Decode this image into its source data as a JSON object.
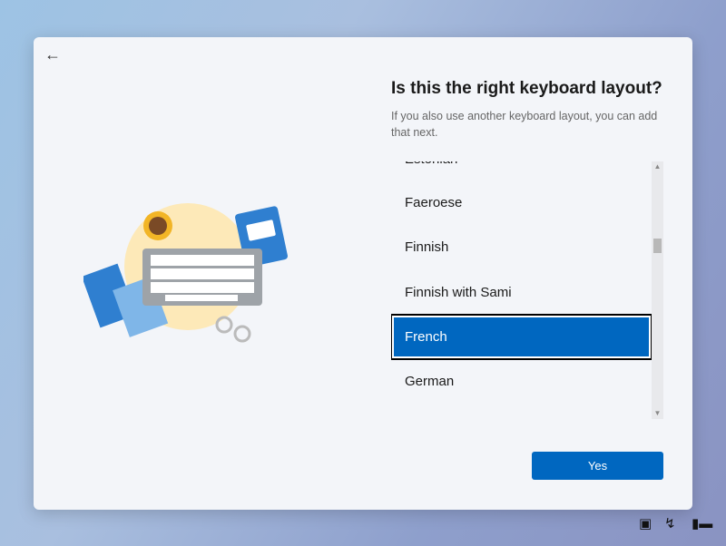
{
  "title": "Is this the right keyboard layout?",
  "subtitle": "If you also use another keyboard layout, you can add that next.",
  "layouts": [
    "Estonian",
    "Faeroese",
    "Finnish",
    "Finnish with Sami",
    "French",
    "German"
  ],
  "selected": "French",
  "yes_label": "Yes",
  "tray": {
    "accessibility": "accessibility-icon",
    "network": "network-icon",
    "battery": "battery-icon"
  },
  "colors": {
    "accent": "#0067c0"
  }
}
